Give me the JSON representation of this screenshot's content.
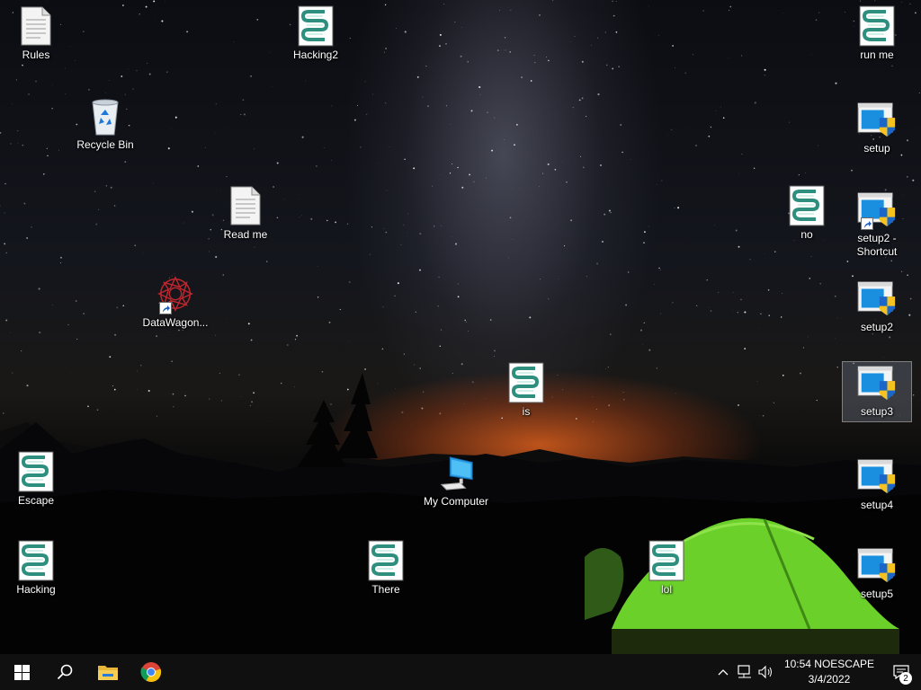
{
  "desktop": {
    "icons": {
      "rules": {
        "label": "Rules",
        "icon": "text-document-icon"
      },
      "hacking2": {
        "label": "Hacking2",
        "icon": "script-icon"
      },
      "run_me": {
        "label": "run me",
        "icon": "script-icon"
      },
      "recycle_bin": {
        "label": "Recycle Bin",
        "icon": "recycle-bin-icon"
      },
      "setup": {
        "label": "setup",
        "icon": "installer-icon"
      },
      "read_me": {
        "label": "Read me",
        "icon": "text-document-icon"
      },
      "no": {
        "label": "no",
        "icon": "script-icon"
      },
      "setup2_shortcut": {
        "label": "setup2 - Shortcut",
        "icon": "installer-icon"
      },
      "datawagon": {
        "label": "DataWagon...",
        "icon": "datawagon-app-icon"
      },
      "setup2": {
        "label": "setup2",
        "icon": "installer-icon"
      },
      "is": {
        "label": "is",
        "icon": "script-icon"
      },
      "setup3": {
        "label": "setup3",
        "icon": "installer-icon"
      },
      "escape": {
        "label": "Escape",
        "icon": "script-icon"
      },
      "my_computer": {
        "label": "My Computer",
        "icon": "computer-icon"
      },
      "setup4": {
        "label": "setup4",
        "icon": "installer-icon"
      },
      "hacking": {
        "label": "Hacking",
        "icon": "script-icon"
      },
      "there": {
        "label": "There",
        "icon": "script-icon"
      },
      "lol": {
        "label": "lol",
        "icon": "script-icon"
      },
      "setup5": {
        "label": "setup5",
        "icon": "installer-icon"
      }
    }
  },
  "taskbar": {
    "start": "windows-start-icon",
    "search": "search-icon",
    "pinned": [
      "file-explorer-icon",
      "chrome-icon"
    ],
    "tray": {
      "icons": [
        "chevron-up-icon",
        "network-icon",
        "volume-icon"
      ],
      "time": "10:54 NOESCAPE",
      "date": "3/4/2022",
      "notification_count": "2"
    }
  },
  "colors": {
    "taskbar": "#101010",
    "tent": "#6bd12a",
    "horizon_glow": "#dc5f1e",
    "selection": "#78829699"
  }
}
